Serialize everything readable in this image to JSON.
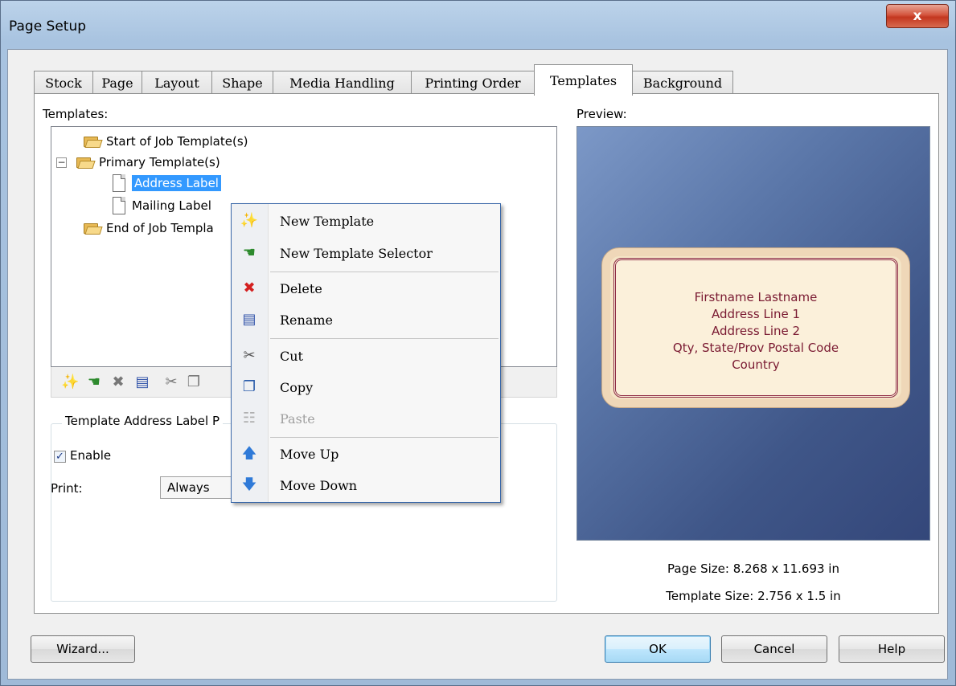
{
  "window": {
    "title": "Page Setup",
    "close_label": "x"
  },
  "tabs": [
    {
      "label": "Stock"
    },
    {
      "label": "Page"
    },
    {
      "label": "Layout"
    },
    {
      "label": "Shape"
    },
    {
      "label": "Media Handling"
    },
    {
      "label": "Printing Order"
    },
    {
      "label": "Templates"
    },
    {
      "label": "Background"
    }
  ],
  "templates": {
    "label": "Templates:",
    "tree": [
      {
        "label": "Start of Job Template(s)",
        "type": "folder"
      },
      {
        "label": "Primary Template(s)",
        "type": "folder",
        "expander": "−"
      },
      {
        "label": "Address Label",
        "type": "doc",
        "selected": true
      },
      {
        "label": "Mailing Label",
        "type": "doc"
      },
      {
        "label": "End of Job Templa",
        "type": "folder"
      }
    ]
  },
  "toolbar": {
    "icons": [
      "new-template-icon",
      "new-template-selector-icon",
      "delete-icon",
      "rename-icon",
      "cut-icon",
      "copy-icon"
    ]
  },
  "group": {
    "title": "Template Address Label P",
    "enable_label": "Enable",
    "enable_checked": true,
    "print_label": "Print:",
    "print_value": "Always"
  },
  "context_menu": {
    "items": [
      {
        "label": "New Template",
        "icon": "new-template-icon",
        "disabled": false
      },
      {
        "label": "New Template Selector",
        "icon": "new-template-selector-icon",
        "disabled": false
      },
      {
        "label": "Delete",
        "icon": "delete-icon",
        "disabled": false
      },
      {
        "label": "Rename",
        "icon": "rename-icon",
        "disabled": false
      },
      {
        "label": "Cut",
        "icon": "cut-icon",
        "disabled": false
      },
      {
        "label": "Copy",
        "icon": "copy-icon",
        "disabled": false
      },
      {
        "label": "Paste",
        "icon": "paste-icon",
        "disabled": true
      },
      {
        "label": "Move Up",
        "icon": "arrow-up-icon",
        "disabled": false
      },
      {
        "label": "Move Down",
        "icon": "arrow-down-icon",
        "disabled": false
      }
    ]
  },
  "preview": {
    "label": "Preview:",
    "label_lines": [
      "Firstname Lastname",
      "Address Line 1",
      "Address Line 2",
      "Qty, State/Prov Postal Code",
      "Country"
    ],
    "page_size": "Page Size:  8.268 x 11.693 in",
    "template_size": "Template Size:  2.756 x 1.5 in"
  },
  "buttons": {
    "wizard": "Wizard...",
    "ok": "OK",
    "cancel": "Cancel",
    "help": "Help"
  },
  "colors": {
    "selection": "#3399ff",
    "accent": "#3a68a8",
    "label_text": "#7a1a32"
  }
}
